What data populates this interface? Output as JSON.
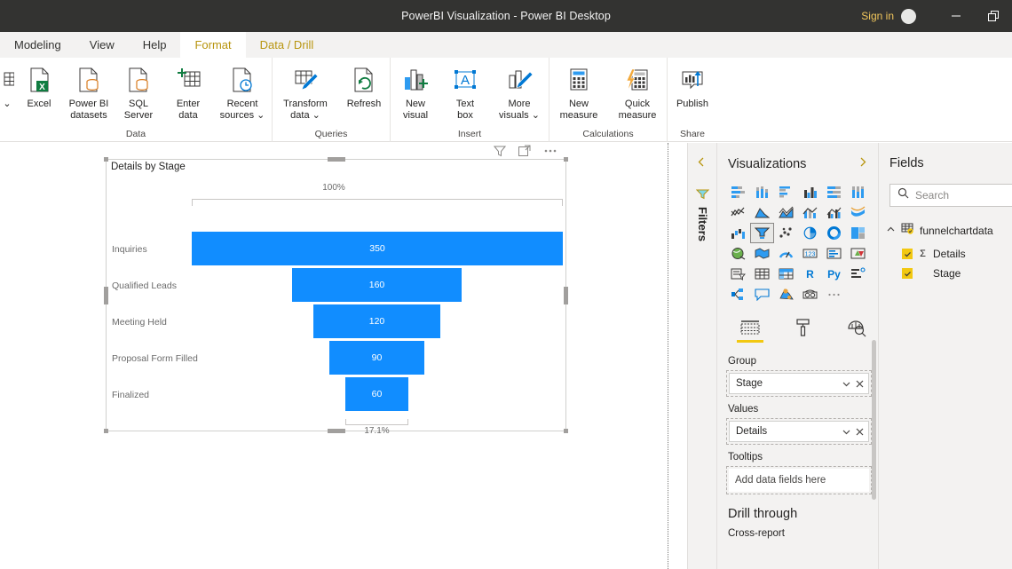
{
  "window": {
    "title": "PowerBI Visualization - Power BI Desktop",
    "sign_in": "Sign in",
    "minimize_icon": "minimize-icon",
    "restore_icon": "restore-icon",
    "avatar_icon": "account-avatar"
  },
  "ribbon": {
    "tabs": [
      {
        "label": "Modeling",
        "state": "normal"
      },
      {
        "label": "View",
        "state": "normal"
      },
      {
        "label": "Help",
        "state": "normal"
      },
      {
        "label": "Format",
        "state": "active"
      },
      {
        "label": "Data / Drill",
        "state": "accent"
      }
    ],
    "groups": [
      {
        "name": "Data",
        "items": [
          {
            "label": "Excel",
            "icon": "excel-icon"
          },
          {
            "label": "Power BI\ndatasets",
            "icon": "powerbi-datasets-icon"
          },
          {
            "label": "SQL\nServer",
            "icon": "sql-server-icon"
          },
          {
            "label": "Enter\ndata",
            "icon": "enter-data-icon"
          },
          {
            "label": "Recent\nsources ⌄",
            "icon": "recent-sources-icon"
          }
        ]
      },
      {
        "name": "Queries",
        "items": [
          {
            "label": "Transform\ndata ⌄",
            "icon": "transform-data-icon"
          },
          {
            "label": "Refresh",
            "icon": "refresh-icon"
          }
        ]
      },
      {
        "name": "Insert",
        "items": [
          {
            "label": "New\nvisual",
            "icon": "new-visual-icon"
          },
          {
            "label": "Text\nbox",
            "icon": "text-box-icon"
          },
          {
            "label": "More\nvisuals ⌄",
            "icon": "more-visuals-icon"
          }
        ]
      },
      {
        "name": "Calculations",
        "items": [
          {
            "label": "New\nmeasure",
            "icon": "new-measure-icon"
          },
          {
            "label": "Quick\nmeasure",
            "icon": "quick-measure-icon"
          }
        ]
      },
      {
        "name": "Share",
        "items": [
          {
            "label": "Publish",
            "icon": "publish-icon"
          }
        ]
      }
    ]
  },
  "visual_header": {
    "filter_icon": "filter-icon",
    "focus_mode_icon": "focus-mode-icon",
    "more_options_icon": "more-options-icon"
  },
  "chart_data": {
    "type": "bar",
    "title": "Details by Stage",
    "categories": [
      "Inquiries",
      "Qualified Leads",
      "Meeting Held",
      "Proposal Form Filled",
      "Finalized"
    ],
    "values": [
      350,
      160,
      120,
      90,
      60
    ],
    "value_labels": [
      "350",
      "160",
      "120",
      "90",
      "60"
    ],
    "top_percent": "100%",
    "bottom_percent": "17.1%",
    "xlabel": "",
    "ylabel": "",
    "legend": "none",
    "grid": false,
    "bar_color": "#118DFF"
  },
  "filters_rail": {
    "label": "Filters",
    "collapse_icon": "chevron-left-icon",
    "funnel_icon": "filter-funnel-icon"
  },
  "visualizations": {
    "title": "Visualizations",
    "expand_icon": "chevron-right-icon",
    "gallery": [
      {
        "name": "stacked-bar-chart",
        "selected": false
      },
      {
        "name": "stacked-column-chart",
        "selected": false
      },
      {
        "name": "clustered-bar-chart",
        "selected": false
      },
      {
        "name": "clustered-column-chart",
        "selected": false
      },
      {
        "name": "100-stacked-bar-chart",
        "selected": false
      },
      {
        "name": "100-stacked-column-chart",
        "selected": false
      },
      {
        "name": "line-chart",
        "selected": false
      },
      {
        "name": "area-chart",
        "selected": false
      },
      {
        "name": "stacked-area-chart",
        "selected": false
      },
      {
        "name": "line-stacked-column-chart",
        "selected": false
      },
      {
        "name": "line-clustered-column-chart",
        "selected": false
      },
      {
        "name": "ribbon-chart",
        "selected": false
      },
      {
        "name": "waterfall-chart",
        "selected": false
      },
      {
        "name": "funnel-chart",
        "selected": true
      },
      {
        "name": "scatter-chart",
        "selected": false
      },
      {
        "name": "pie-chart",
        "selected": false
      },
      {
        "name": "donut-chart",
        "selected": false
      },
      {
        "name": "treemap-chart",
        "selected": false
      },
      {
        "name": "map-visual",
        "selected": false
      },
      {
        "name": "filled-map-visual",
        "selected": false
      },
      {
        "name": "gauge-visual",
        "selected": false
      },
      {
        "name": "card-visual",
        "selected": false
      },
      {
        "name": "multi-row-card-visual",
        "selected": false
      },
      {
        "name": "kpi-visual",
        "selected": false
      },
      {
        "name": "slicer-visual",
        "selected": false
      },
      {
        "name": "table-visual",
        "selected": false
      },
      {
        "name": "matrix-visual",
        "selected": false
      },
      {
        "name": "r-script-visual",
        "selected": false
      },
      {
        "name": "python-visual",
        "selected": false
      },
      {
        "name": "key-influencers-visual",
        "selected": false
      },
      {
        "name": "decomposition-tree-visual",
        "selected": false
      },
      {
        "name": "q-and-a-visual",
        "selected": false
      },
      {
        "name": "arcgis-maps-visual",
        "selected": false
      },
      {
        "name": "paginated-report-visual",
        "selected": false
      },
      {
        "name": "more-visuals-ellipsis",
        "selected": false
      }
    ],
    "pane_tabs": [
      {
        "name": "fields-tab",
        "icon": "fields-grid-icon",
        "active": true
      },
      {
        "name": "format-tab",
        "icon": "paint-roller-icon",
        "active": false
      },
      {
        "name": "analytics-tab",
        "icon": "analytics-magnifier-icon",
        "active": false
      }
    ],
    "wells": [
      {
        "label": "Group",
        "value": "Stage",
        "empty": false
      },
      {
        "label": "Values",
        "value": "Details",
        "empty": false
      },
      {
        "label": "Tooltips",
        "value": "Add data fields here",
        "empty": true
      }
    ],
    "chip_dropdown_icon": "chevron-down-icon",
    "chip_remove_icon": "remove-field-icon",
    "drill_through_title": "Drill through",
    "cross_report_label": "Cross-report"
  },
  "fields": {
    "title": "Fields",
    "search_placeholder": "Search",
    "search_icon": "search-icon",
    "search_value": "",
    "tree": {
      "table": "funnelchartdata",
      "collapse_icon": "chevron-up-icon",
      "table_icon": "table-icon",
      "children": [
        {
          "label": "Details",
          "aggregate": "Σ",
          "checked": true
        },
        {
          "label": "Stage",
          "aggregate": "",
          "checked": true
        }
      ]
    }
  }
}
